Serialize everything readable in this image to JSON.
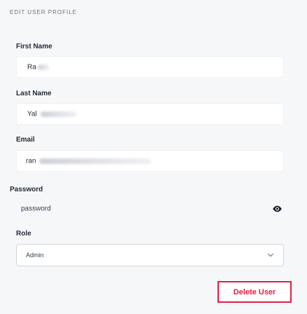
{
  "form": {
    "section_title": "EDIT USER PROFILE",
    "first_name": {
      "label": "First Name",
      "value": "Ra"
    },
    "last_name": {
      "label": "Last Name",
      "value": "Yal"
    },
    "email": {
      "label": "Email",
      "value": "ran"
    },
    "password": {
      "label": "Password",
      "value": "password"
    },
    "role": {
      "label": "Role",
      "value": "Admin"
    }
  },
  "actions": {
    "delete_label": "Delete User",
    "delete_color": "#e11d48"
  },
  "icons": {
    "visibility": "eye-icon",
    "dropdown": "chevron-down-icon"
  }
}
